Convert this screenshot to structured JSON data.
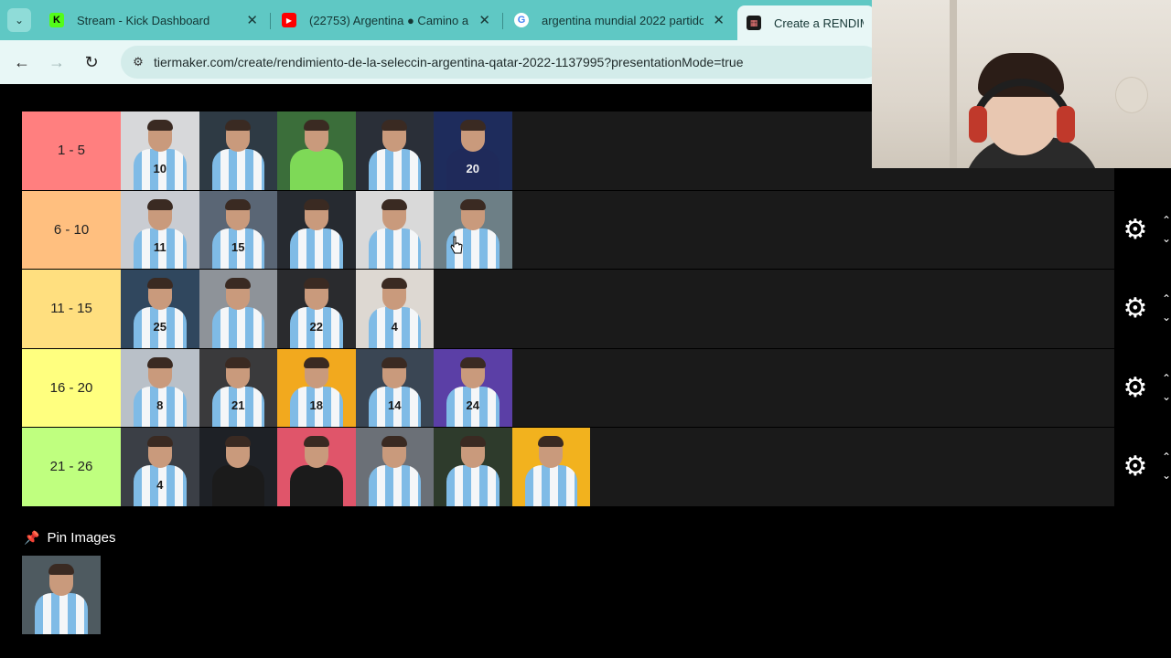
{
  "browser": {
    "tabs": [
      {
        "title": "Stream - Kick Dashboard",
        "favicon": "kick-favicon-icon",
        "color": "#53fc18",
        "active": false
      },
      {
        "title": "(22753) Argentina ● Camino a l",
        "favicon": "youtube-favicon-icon",
        "color": "#ff0000",
        "active": false
      },
      {
        "title": "argentina mundial 2022 partido",
        "favicon": "google-favicon-icon",
        "color": "#4285f4",
        "active": false
      },
      {
        "title": "Create a RENDIMIEN",
        "favicon": "tiermaker-favicon-icon",
        "color": "#000000",
        "active": true
      }
    ],
    "url": "tiermaker.com/create/rendimiento-de-la-seleccin-argentina-qatar-2022-1137995?presentationMode=true"
  },
  "tiers": [
    {
      "label": "1 - 5",
      "color": "#ff7f7f",
      "items": [
        "10",
        "",
        "",
        "",
        "20"
      ]
    },
    {
      "label": "6 - 10",
      "color": "#ffbf7f",
      "items": [
        "11",
        "15",
        "",
        "",
        ""
      ]
    },
    {
      "label": "11 - 15",
      "color": "#ffdf7f",
      "items": [
        "25",
        "",
        "22",
        "4"
      ]
    },
    {
      "label": "16 - 20",
      "color": "#ffff7f",
      "items": [
        "8",
        "21",
        "18",
        "14",
        "24"
      ]
    },
    {
      "label": "21 - 26",
      "color": "#bfff7f",
      "items": [
        "4",
        "",
        "",
        "",
        "",
        ""
      ]
    }
  ],
  "pin": {
    "title": "Pin Images",
    "items": [
      ""
    ]
  }
}
